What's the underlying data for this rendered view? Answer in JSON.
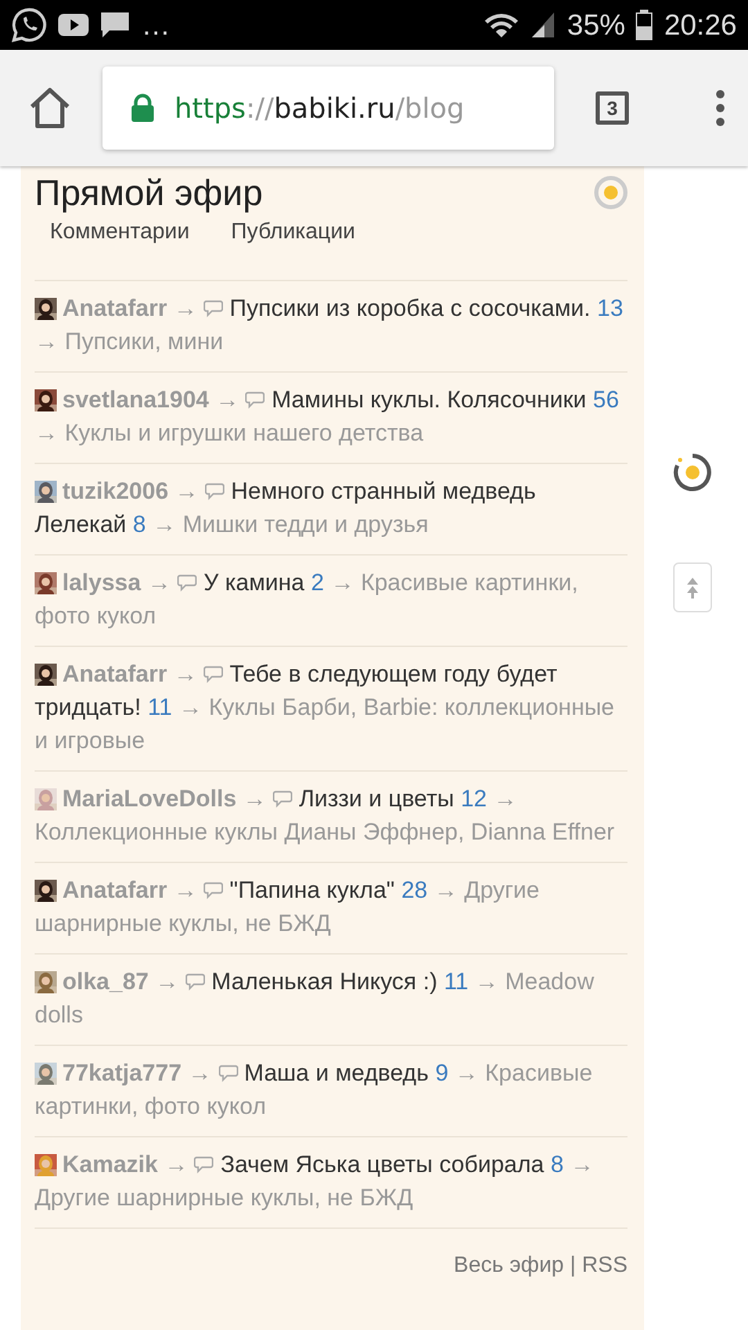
{
  "status_bar": {
    "overflow": "…",
    "battery": "35%",
    "time": "20:26"
  },
  "browser": {
    "url_scheme": "https",
    "url_separator": "://",
    "url_host": "babiki.ru",
    "url_path": "/blog",
    "tab_count": "3"
  },
  "widget": {
    "title": "Прямой эфир",
    "tabs": [
      {
        "label": "Комментарии",
        "selected": false
      },
      {
        "label": "Публикации",
        "selected": false
      }
    ],
    "rows": [
      {
        "user": "Anatafarr",
        "arrow_1": "→",
        "title": "Пупсики из коробка с сосочками.",
        "count": "13",
        "arrow_2": "→",
        "category": "Пупсики, мини"
      },
      {
        "user": "svetlana1904",
        "arrow_1": "→",
        "title": "Мамины куклы. Колясочники",
        "count": "56",
        "arrow_2": "→",
        "category": "Куклы и игрушки нашего детства"
      },
      {
        "user": "tuzik2006",
        "arrow_1": "→",
        "title": "Немного странный медведь Лелекай",
        "count": "8",
        "arrow_2": "→",
        "category": "Мишки тедди и друзья"
      },
      {
        "user": "lalyssa",
        "arrow_1": "→",
        "title": "У камина",
        "count": "2",
        "arrow_2": "→",
        "category": "Красивые картинки, фото кукол"
      },
      {
        "user": "Anatafarr",
        "arrow_1": "→",
        "title": "Тебе в следующем году будет тридцать!",
        "count": "11",
        "arrow_2": "→",
        "category": "Куклы Барби, Barbie: коллекционные и игровые"
      },
      {
        "user": "MariaLoveDolls",
        "arrow_1": "→",
        "title": "Лиззи и цветы",
        "count": "12",
        "arrow_2": "→",
        "category": "Коллекционные куклы Дианы Эффнер, Dianna Effner"
      },
      {
        "user": "Anatafarr",
        "arrow_1": "→",
        "title": "\"Папина кукла\"",
        "count": "28",
        "arrow_2": "→",
        "category": "Другие шарнирные куклы, не БЖД"
      },
      {
        "user": "olka_87",
        "arrow_1": "→",
        "title": "Маленькая Никуся :)",
        "count": "11",
        "arrow_2": "→",
        "category": "Meadow dolls"
      },
      {
        "user": "77katja777",
        "arrow_1": "→",
        "title": "Маша и медведь",
        "count": "9",
        "arrow_2": "→",
        "category": "Красивые картинки, фото кукол"
      },
      {
        "user": "Kamazik",
        "arrow_1": "→",
        "title": "Зачем Яська цветы собирала",
        "count": "8",
        "arrow_2": "→",
        "category": "Другие шарнирные куклы, не БЖД"
      }
    ],
    "footer": {
      "all_link": "Весь эфир",
      "separator": "|",
      "rss_link": "RSS"
    }
  }
}
